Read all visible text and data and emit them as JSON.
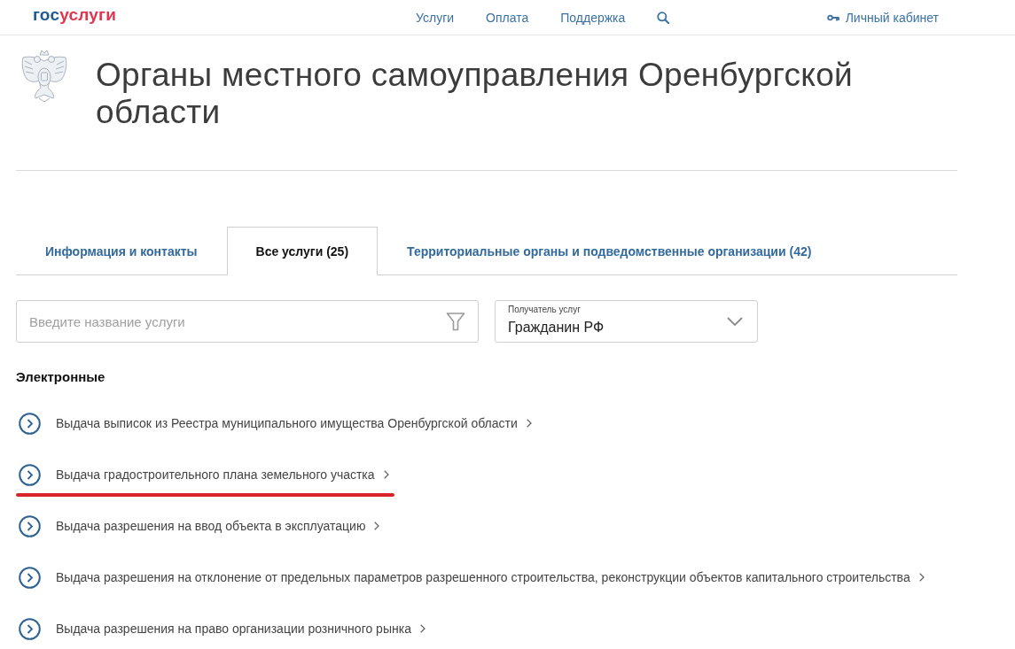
{
  "header": {
    "logo": {
      "part_1": "гос",
      "part_2": "услуги"
    },
    "nav": [
      "Услуги",
      "Оплата",
      "Поддержка"
    ],
    "account": "Личный кабинет"
  },
  "page": {
    "title": "Органы местного самоуправления Оренбургской области"
  },
  "tabs": [
    {
      "label": "Информация и контакты",
      "selected": false
    },
    {
      "label": "Все услуги (25)",
      "selected": true
    },
    {
      "label": "Территориальные органы и подведомственные организации (42)",
      "selected": false
    }
  ],
  "filters": {
    "search": {
      "placeholder": "Введите название услуги"
    },
    "recipient": {
      "label": "Получатель услуг",
      "value": "Гражданин РФ"
    }
  },
  "section": {
    "title": "Электронные",
    "services": [
      {
        "title": "Выдача выписок из Реестра муниципального имущества Оренбургской области",
        "marked": false
      },
      {
        "title": "Выдача градостроительного плана земельного участка",
        "marked": true
      },
      {
        "title": "Выдача разрешения на ввод объекта в эксплуатацию",
        "marked": false
      },
      {
        "title": "Выдача разрешения на отклонение от предельных параметров разрешенного строительства, реконструкции объектов капитального строительства",
        "marked": false
      },
      {
        "title": "Выдача разрешения на право организации розничного рынка",
        "marked": false
      }
    ]
  }
}
